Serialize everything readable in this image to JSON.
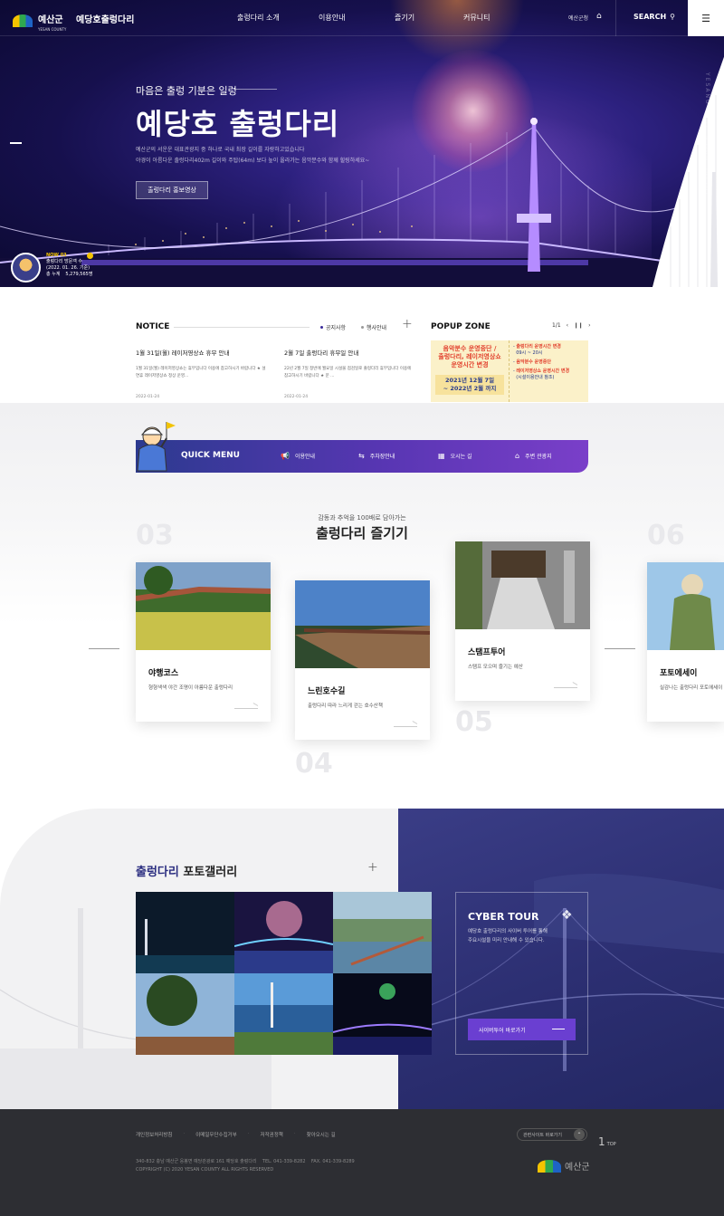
{
  "header": {
    "logo_text": "예산군",
    "logo_sub": "YESAN COUNTY",
    "site_title": "예당호출렁다리",
    "nav": [
      "출렁다리 소개",
      "이용안내",
      "즐기기",
      "커뮤니티"
    ],
    "lang": "예산군청",
    "search_label": "SEARCH"
  },
  "hero": {
    "subtitle": "마음은 출렁 기분은 일렁",
    "title": "예당호 출렁다리",
    "desc_line1": "예산군의 서운운 대표관광지 중 하나로 국내 최장 길이를 자랑하고있습니다",
    "desc_line2": "야경이 아름다운 출렁다리402m 길이와 주탑(64m) 보다 높이 올라가는 음악분수와 함께 힐링하세요~",
    "button": "출렁다리 홍보영상",
    "vertical_text": "YESANG SUSPENSION BRIDGE"
  },
  "visitor": {
    "now": "NOW 03",
    "label": "출렁다리 방문객 수",
    "date": "(2022. 01. 26. 기준)",
    "total_label": "총 누계",
    "total_value": "5,279,565명"
  },
  "notice": {
    "heading": "NOTICE",
    "tabs": [
      "공지사항",
      "행사안내"
    ],
    "items": [
      {
        "title": "1월 31일(월) 레이저영상쇼 휴무 안내",
        "body": "1월 31일(월) 레이저영상쇼는 휴무입니다 이용에 참고하시기 바랍니다 ★ 설연휴 레이저영상쇼 정상 운영...",
        "date": "2022-01-24"
      },
      {
        "title": "2월 7일 출렁다리 휴무일 안내",
        "body": "22년 2월 7일 정반에 월요일 시설물 점검일로 출렁다리 휴무입니다 이용에 참고하시기 바랍니다 ★ 문 ...",
        "date": "2022-01-24"
      }
    ]
  },
  "popup": {
    "heading": "POPUP ZONE",
    "page": "1/1",
    "left_line1": "음악분수 운영중단 /",
    "left_line2": "출렁다리, 레이저영상쇼",
    "left_line3": "운영시간 변경",
    "period_line1": "2021년 12월 7일",
    "period_line2": "~ 2022년 2월 까지",
    "right_items": [
      {
        "title": "출렁다리 운영시간 변경",
        "sub": "09시 ~ 20시"
      },
      {
        "title": "음악분수 운영중단",
        "sub": ""
      },
      {
        "title": "레이저영상쇼 운영시간 변경",
        "sub": "(시설이용안내 참조)"
      }
    ]
  },
  "quick": {
    "title": "QUICK MENU",
    "items": [
      {
        "icon": "megaphone-icon",
        "label": "이용안내"
      },
      {
        "icon": "parking-icon",
        "label": "주차장안내"
      },
      {
        "icon": "building-icon",
        "label": "오시는 길"
      },
      {
        "icon": "landmark-icon",
        "label": "주변 관광지"
      }
    ]
  },
  "enjoy": {
    "subtitle": "감동과 추억을 100배로 담아가는",
    "title": "출렁다리 즐기기",
    "numbers": [
      "03",
      "04",
      "05",
      "06"
    ],
    "cards": [
      {
        "title": "야행코스",
        "desc": "형형색색 야간 조명이 아름다운 출렁다리"
      },
      {
        "title": "느린호수길",
        "desc": "출렁다리 따라 느리게 걷는 호수산책"
      },
      {
        "title": "스탬프투어",
        "desc": "스탬프 모으며 즐기는 예산"
      },
      {
        "title": "포토에세이",
        "desc": "실감나는 출렁다리 포토에세이"
      }
    ]
  },
  "gallery": {
    "title_part1": "출렁다리",
    "title_part2": "포토갤러리"
  },
  "cyber": {
    "title": "CYBER TOUR",
    "desc_line1": "예당호 출렁다리의 사이버 투어를 통해",
    "desc_line2": "주요시설을 미리 안내해 수 있습니다.",
    "button": "사이버투어 바로가기"
  },
  "footer": {
    "links": [
      "개인정보처리방침",
      "이메일무단수집거부",
      "저작권정책",
      "찾아오시는 길"
    ],
    "addr_line1": "340-832 충남 예산군 응봉면 예당관광로 161 예당호 출렁다리    TEL. 041-339-8282    FAX. 041-339-8289",
    "addr_line2": "COPYRIGHT (C) 2020 YESAN COUNTY ALL RIGHTS RESERVED",
    "related": "관련사이트 바로가기",
    "top_num": "1",
    "top_label": "TOP",
    "logo_text": "예산군"
  },
  "colors": {
    "brand_purple": "#5836b3",
    "navy": "#2b2e80",
    "popup_red": "#e2402d"
  }
}
